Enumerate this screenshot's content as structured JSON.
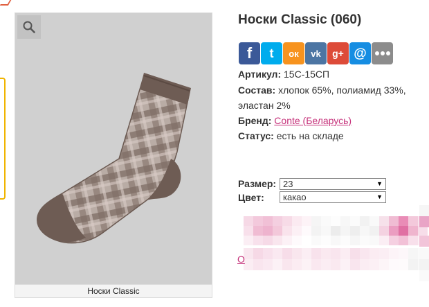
{
  "product": {
    "title": "Носки Classic (060)",
    "image_caption": "Носки Classic"
  },
  "share": {
    "icons": [
      "facebook-icon",
      "twitter-icon",
      "odnoklassniki-icon",
      "vk-icon",
      "google-plus-icon",
      "mailru-icon",
      "more-icon"
    ],
    "facebook_glyph": "f",
    "twitter_glyph": "t",
    "ok_glyph": "ок",
    "vk_glyph": "vk",
    "gplus_glyph": "g+",
    "mailru_glyph": "@"
  },
  "specs": {
    "article_label": "Артикул:",
    "article_value": "15С-15СП",
    "composition_label": "Состав:",
    "composition_value": "хлопок 65%, полиамид 33%, эластан 2%",
    "brand_label": "Бренд:",
    "brand_value": "Conte (Беларусь)",
    "status_label": "Статус:",
    "status_value": "есть на складе"
  },
  "options": {
    "size_label": "Размер:",
    "size_value": "23",
    "color_label": "Цвет:",
    "color_value": "какао"
  },
  "misc": {
    "stray_link_text": "О"
  },
  "colors": {
    "brand_link": "#c5317a",
    "sock_dark": "#6e5c54",
    "sock_light": "#b7a9a2"
  }
}
